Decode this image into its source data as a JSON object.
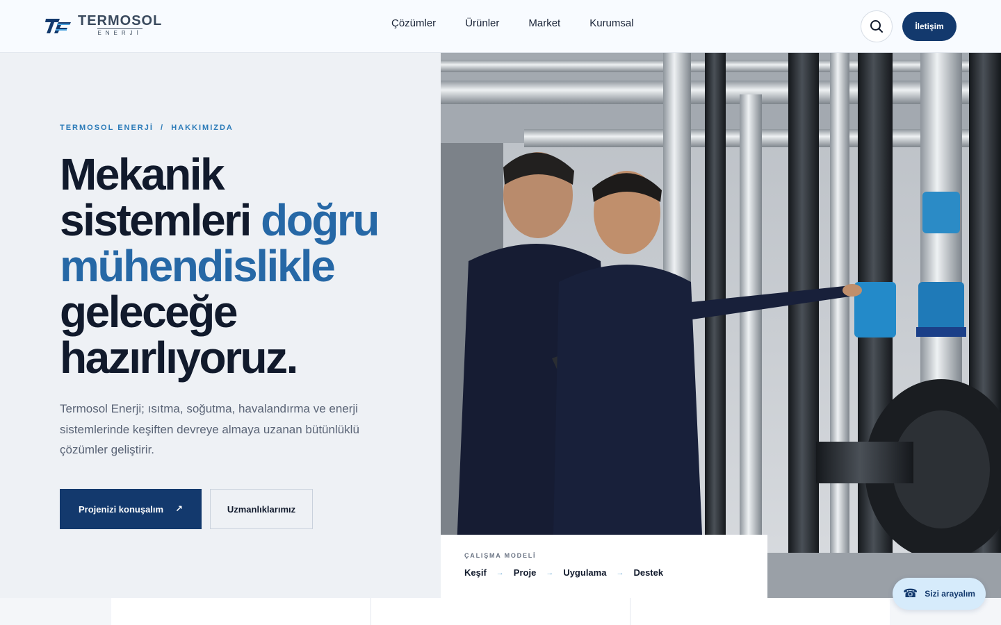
{
  "header": {
    "logo_name": "TERMOSOL",
    "logo_sub": "ENERJİ",
    "nav": [
      "Çözümler",
      "Ürünler",
      "Market",
      "Kurumsal"
    ],
    "search_icon": "search-icon",
    "contact_label": "İletişim"
  },
  "hero": {
    "breadcrumb": "TERMOSOL ENERJİ  /  HAKKIMIZDA",
    "headline_part1": "Mekanik sistemleri ",
    "headline_accent": "doğru mühendislikle",
    "headline_part2": " geleceğe hazırlıyoruz.",
    "lead": "Termosol Enerji; ısıtma, soğutma, havalandırma ve enerji sistemlerinde keşiften devreye almaya uzanan bütünlüklü çözümler geliştirir.",
    "primary_button": "Projenizi konuşalım",
    "primary_button_icon": "↗",
    "secondary_button": "Uzmanlıklarımız"
  },
  "work_model": {
    "title": "ÇALIŞMA MODELİ",
    "steps": [
      "Keşif",
      "Proje",
      "Uygulama",
      "Destek"
    ],
    "arrow": "→"
  },
  "call": {
    "icon": "phone-icon",
    "glyph": "☎",
    "label": "Sizi arayalım"
  },
  "colors": {
    "primary": "#13396d",
    "accent": "#2668a6",
    "breadcrumb": "#2a7ab8",
    "hero_bg": "#eef1f5"
  }
}
